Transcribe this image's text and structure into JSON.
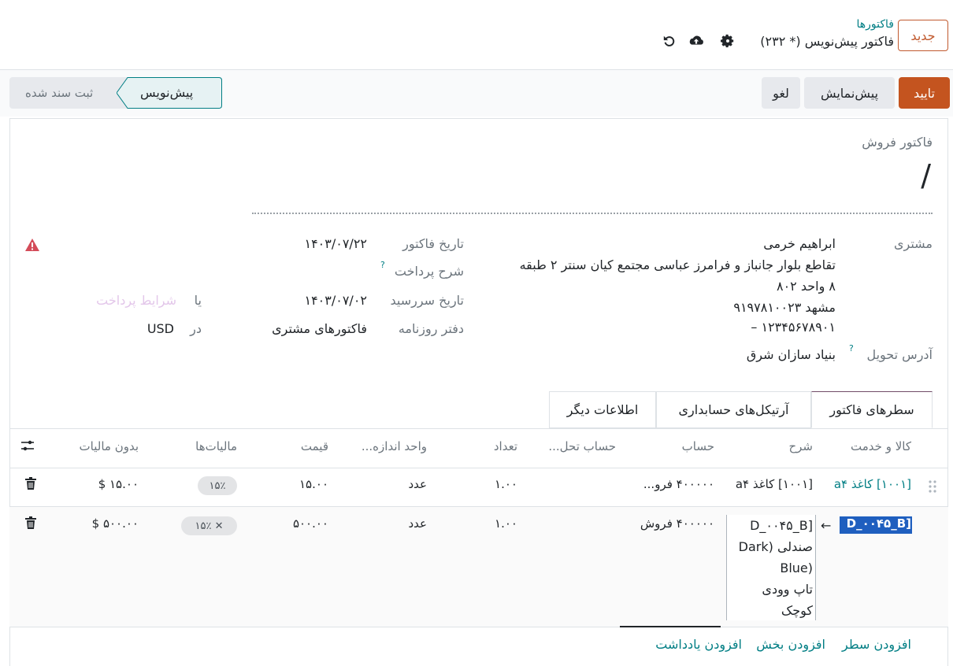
{
  "topbar": {
    "new_button": "جدید",
    "breadcrumb": "فاکتورها",
    "record_title": "فاکتور پیش‌نویس (* ۲۳۲)"
  },
  "actions": {
    "confirm": "تایید",
    "preview": "پیش‌نمایش",
    "cancel": "لغو"
  },
  "statusbar": {
    "draft": "پیش‌نویس",
    "posted": "ثبت سند شده"
  },
  "invoice": {
    "type_label": "فاکتور فروش",
    "number": "/",
    "customer_label": "مشتری",
    "customer_name": "ابراهیم خرمی",
    "address_line1": "تقاطع بلوار جانباز و فرامرز عباسی مجتمع کیان سنتر ۲ طبقه",
    "address_line2": "۸ واحد ۸۰۲",
    "address_line3": "مشهد ۹۱۹۷۸۱۰۰۲۳",
    "address_line4": "۱۲۳۴۵۶۷۸۹۰۱ –",
    "delivery_label": "آدرس تحویل",
    "delivery_value": "بنیاد سازان شرق",
    "invoice_date_label": "تاریخ فاکتور",
    "invoice_date": "۱۴۰۳/۰۷/۲۲",
    "payment_ref_label": "شرح پرداخت",
    "due_date_label": "تاریخ سررسید",
    "due_date": "۱۴۰۳/۰۷/۰۲",
    "or_label": "یا",
    "payment_terms_placeholder": "شرایط پرداخت",
    "journal_label": "دفتر روزنامه",
    "journal_value": "فاکتورهای مشتری",
    "in_label": "در",
    "currency": "USD",
    "help_mark": "?"
  },
  "tabs": [
    "سطرهای فاکتور",
    "آرتیکل‌های حسابداری",
    "اطلاعات دیگر"
  ],
  "table": {
    "headers": {
      "product": "کالا و خدمت",
      "description": "شرح",
      "account": "حساب",
      "analytic": "حساب تحل...",
      "quantity": "تعداد",
      "uom": "واحد اندازه...",
      "price": "قیمت",
      "taxes": "مالیات‌ها",
      "subtotal": "بدون مالیات"
    },
    "rows": [
      {
        "product": "[۱۰۰۱] کاغذ a۴",
        "description": "[۱۰۰۱] کاغذ a۴",
        "account": "۴۰۰۰۰۰ فرو...",
        "quantity": "۱.۰۰",
        "uom": "عدد",
        "price": "۱۵.۰۰",
        "tax": "۱۵٪",
        "subtotal": "۱۵.۰۰ $"
      },
      {
        "product": "[D_۰۰۴۵_B",
        "description_lines": [
          "[D_۰۰۴۵_B",
          "صندلی (Dark",
          "(Blue",
          "تاپ وودی",
          "کوچک"
        ],
        "account": "۴۰۰۰۰۰ فروش",
        "quantity": "۱.۰۰",
        "uom": "عدد",
        "price": "۵۰۰.۰۰",
        "tax": "۱۵٪",
        "subtotal": "۵۰۰.۰۰ $"
      }
    ]
  },
  "footer_links": {
    "add_line": "افزودن سطر",
    "add_section": "افزودن بخش",
    "add_note": "افزودن یادداشت"
  },
  "colors": {
    "brand_orange": "#c4541f",
    "teal_link": "#017e84",
    "danger": "#d44c59"
  }
}
